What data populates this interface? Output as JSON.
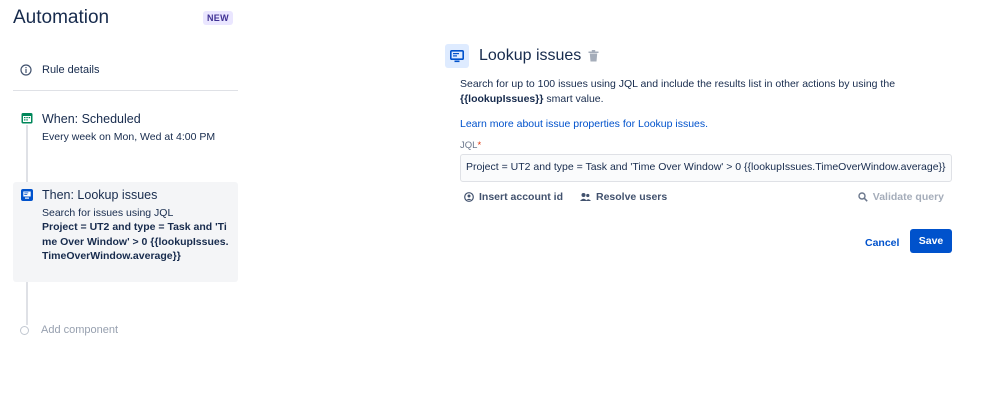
{
  "app": {
    "title": "Automation",
    "badge": "NEW"
  },
  "sidebar": {
    "rule_details": "Rule details",
    "when": {
      "title": "When: Scheduled",
      "subtitle": "Every week on Mon, Wed at 4:00 PM"
    },
    "then": {
      "title": "Then: Lookup issues",
      "subtitle": "Search for issues using JQL",
      "query": "Project = UT2 and type = Task and 'Time Over Window' > 0 {{lookupIssues.TimeOverWindow.average}}"
    },
    "add_component": "Add component"
  },
  "panel": {
    "title": "Lookup issues",
    "description_pre": "Search for up to 100 issues using JQL and include the results list in other actions by using the",
    "description_bold": "{{lookupIssues}}",
    "description_post": " smart value.",
    "learn_more": "Learn more about issue properties for Lookup issues.",
    "jql_label": "JQL",
    "jql_required": "*",
    "jql_value": "Project = UT2 and type = Task and 'Time Over Window' > 0 {{lookupIssues.TimeOverWindow.average}}",
    "tools": {
      "insert": "Insert account id",
      "resolve": "Resolve users",
      "validate": "Validate query"
    },
    "cancel": "Cancel",
    "save": "Save"
  },
  "colors": {
    "primary": "#0052cc",
    "when_icon": "#00875a",
    "then_icon": "#0052cc"
  }
}
